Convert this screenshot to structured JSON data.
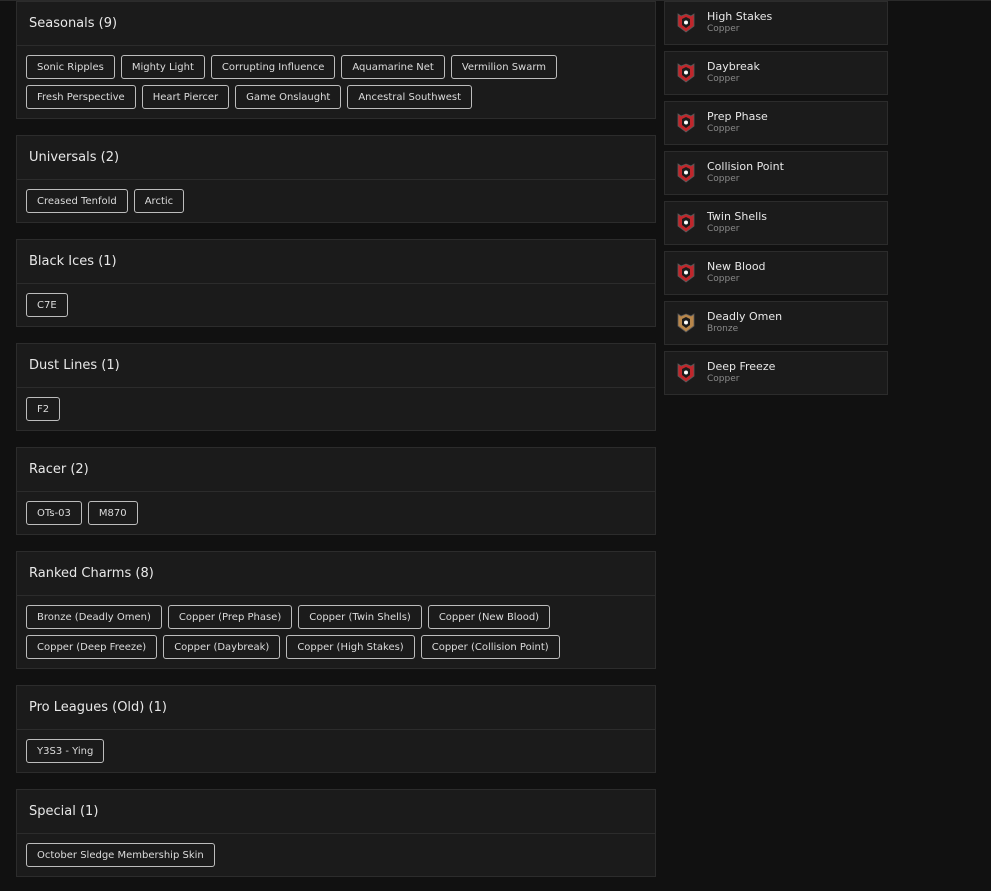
{
  "sections": [
    {
      "title": "Seasonals (9)",
      "items": [
        "Sonic Ripples",
        "Mighty Light",
        "Corrupting Influence",
        "Aquamarine Net",
        "Vermilion Swarm",
        "Fresh Perspective",
        "Heart Piercer",
        "Game Onslaught",
        "Ancestral Southwest"
      ]
    },
    {
      "title": "Universals (2)",
      "items": [
        "Creased Tenfold",
        "Arctic"
      ]
    },
    {
      "title": "Black Ices (1)",
      "items": [
        "C7E"
      ]
    },
    {
      "title": "Dust Lines (1)",
      "items": [
        "F2"
      ]
    },
    {
      "title": "Racer (2)",
      "items": [
        "OTs-03",
        "M870"
      ]
    },
    {
      "title": "Ranked Charms (8)",
      "items": [
        "Bronze (Deadly Omen)",
        "Copper (Prep Phase)",
        "Copper (Twin Shells)",
        "Copper (New Blood)",
        "Copper (Deep Freeze)",
        "Copper (Daybreak)",
        "Copper (High Stakes)",
        "Copper (Collision Point)"
      ]
    },
    {
      "title": "Pro Leagues (Old) (1)",
      "items": [
        "Y3S3 - Ying"
      ]
    },
    {
      "title": "Special (1)",
      "items": [
        "October Sledge Membership Skin"
      ]
    }
  ],
  "charms": [
    {
      "name": "High Stakes",
      "tier": "Copper",
      "icon": "copper-rank-icon",
      "color": "#c0262b"
    },
    {
      "name": "Daybreak",
      "tier": "Copper",
      "icon": "copper-rank-icon",
      "color": "#c0262b"
    },
    {
      "name": "Prep Phase",
      "tier": "Copper",
      "icon": "copper-rank-icon",
      "color": "#c0262b"
    },
    {
      "name": "Collision Point",
      "tier": "Copper",
      "icon": "copper-rank-icon",
      "color": "#c0262b"
    },
    {
      "name": "Twin Shells",
      "tier": "Copper",
      "icon": "copper-rank-icon",
      "color": "#c0262b"
    },
    {
      "name": "New Blood",
      "tier": "Copper",
      "icon": "copper-rank-icon",
      "color": "#c0262b"
    },
    {
      "name": "Deadly Omen",
      "tier": "Bronze",
      "icon": "bronze-rank-icon",
      "color": "#b8864a"
    },
    {
      "name": "Deep Freeze",
      "tier": "Copper",
      "icon": "copper-rank-icon",
      "color": "#c0262b"
    }
  ]
}
